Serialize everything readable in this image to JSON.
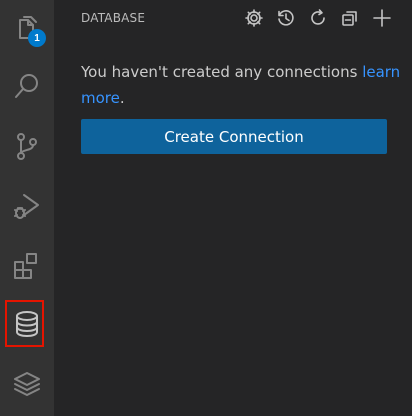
{
  "activity_bar": {
    "items": [
      {
        "name": "explorer",
        "icon": "files-icon",
        "badge": "1"
      },
      {
        "name": "search",
        "icon": "search-icon"
      },
      {
        "name": "source-control",
        "icon": "source-control-icon"
      },
      {
        "name": "run-debug",
        "icon": "run-debug-icon"
      },
      {
        "name": "extensions",
        "icon": "extensions-icon"
      },
      {
        "name": "database",
        "icon": "database-icon",
        "highlighted": true
      },
      {
        "name": "layers",
        "icon": "layers-icon"
      }
    ],
    "highlight_color": "#e51400",
    "badge_color": "#007acc"
  },
  "sidebar": {
    "title": "DATABASE",
    "toolbar": [
      "settings-icon",
      "history-icon",
      "refresh-icon",
      "collapse-all-icon",
      "add-icon"
    ],
    "message_prefix": "You haven't created any connections ",
    "message_link": "learn more",
    "message_suffix": ".",
    "create_button_label": "Create Connection",
    "link_color": "#3794ff",
    "button_color": "#0e639c"
  }
}
